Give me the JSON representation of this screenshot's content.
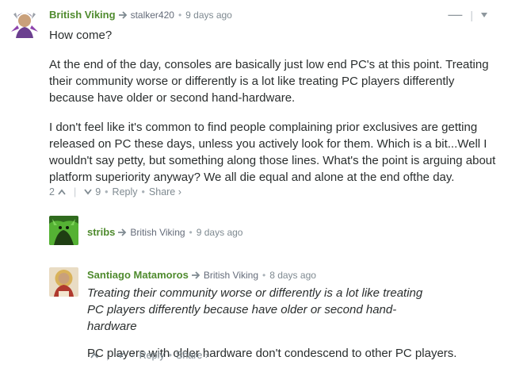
{
  "colors": {
    "author": "#4f8b2e",
    "meta": "#7f8a91",
    "text": "#2a2e2e",
    "background": "#ffffff"
  },
  "comment1": {
    "author": "British Viking",
    "reply_to": "stalker420",
    "dot": "•",
    "time": "9 days ago",
    "collapse_label": "—",
    "menu_divider": "|",
    "paragraphs": [
      "How come?",
      "At the end of the day, consoles are basically just low end PC's at this point. Treating their community worse or differently is a lot like treating PC players differently because have older or second hand-hardware.",
      "I don't feel like it's common to find people complaining prior exclusives are getting released on PC these days, unless you actively look for them. Which is a bit...Well I wouldn't say petty, but something along those lines. What's the point is arguing about platform superiority anyway? We all die equal and alone at the end ofthe day."
    ],
    "upvotes": "2",
    "downvotes": "9",
    "divider": "|",
    "reply_label": "Reply",
    "share_label": "Share ›"
  },
  "comment2": {
    "author": "stribs",
    "reply_to": "British Viking",
    "dot": "•",
    "time": "9 days ago"
  },
  "comment3": {
    "author": "Santiago Matamoros",
    "reply_to": "British Viking",
    "dot": "•",
    "time": "8 days ago",
    "quote": "Treating their community worse or differently is a lot like treating PC players differently because have older or second hand-hardware",
    "text": "PC players with older hardware don't condescend to other PC players.",
    "divider": "|",
    "reply_label": "Reply",
    "share_label": "Share ›"
  }
}
